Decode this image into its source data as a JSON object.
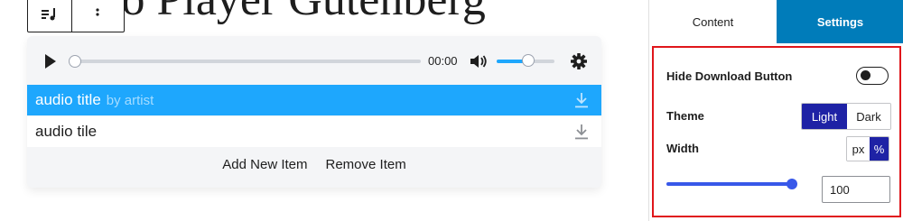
{
  "editor": {
    "title_fragment": "io Player Gutenberg"
  },
  "player": {
    "time": "00:00",
    "progress": 0,
    "volume": 0.55,
    "tracks": [
      {
        "title": "audio title",
        "artist": "by artist",
        "active": true
      },
      {
        "title": "audio tile",
        "artist": "",
        "active": false
      }
    ],
    "add_item_label": "Add New Item",
    "remove_item_label": "Remove Item",
    "accent_color": "#1ea7fd"
  },
  "sidebar": {
    "tabs": [
      {
        "label": "Content",
        "active": false
      },
      {
        "label": "Settings",
        "active": true
      }
    ],
    "hide_download_label": "Hide Download Button",
    "hide_download_on": false,
    "theme_label": "Theme",
    "theme_options": [
      "Light",
      "Dark"
    ],
    "theme_selected": "Light",
    "width_label": "Width",
    "width_units": [
      "px",
      "%"
    ],
    "width_unit_selected": "%",
    "width_value": "100",
    "highlight_color": "#e0161b",
    "selected_color": "#1e22a5"
  }
}
